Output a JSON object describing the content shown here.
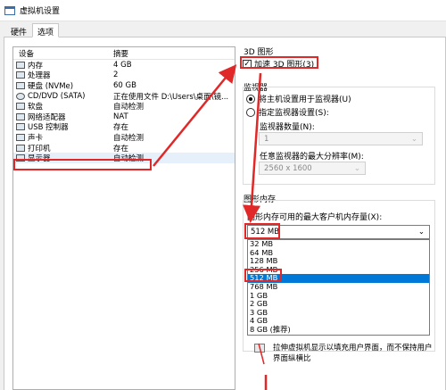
{
  "window": {
    "title": "虚拟机设置"
  },
  "tabs": [
    {
      "label": "硬件"
    },
    {
      "label": "选项"
    }
  ],
  "device_list": {
    "header": {
      "device": "设备",
      "summary": "摘要"
    },
    "rows": [
      {
        "device": "内存",
        "summary": "4 GB",
        "icon": "memory-icon"
      },
      {
        "device": "处理器",
        "summary": "2",
        "icon": "processor-icon"
      },
      {
        "device": "硬盘 (NVMe)",
        "summary": "60 GB",
        "icon": "hard-disk-icon"
      },
      {
        "device": "CD/DVD (SATA)",
        "summary": "正在使用文件 D:\\Users\\桌面\\镜...",
        "icon": "cd-dvd-icon"
      },
      {
        "device": "软盘",
        "summary": "自动检测",
        "icon": "floppy-icon"
      },
      {
        "device": "网络适配器",
        "summary": "NAT",
        "icon": "network-adapter-icon"
      },
      {
        "device": "USB 控制器",
        "summary": "存在",
        "icon": "usb-icon"
      },
      {
        "device": "声卡",
        "summary": "自动检测",
        "icon": "sound-card-icon"
      },
      {
        "device": "打印机",
        "summary": "存在",
        "icon": "printer-icon"
      },
      {
        "device": "显示器",
        "summary": "自动检测",
        "icon": "display-icon"
      }
    ]
  },
  "graphics3d": {
    "section_label": "3D 图形",
    "accelerate_label": "加速 3D 图形(3)",
    "accelerate_checked": true
  },
  "monitors": {
    "section_label": "监视器",
    "use_host_label": "将主机设置用于监视器(U)",
    "specify_label": "指定监视器设置(S):",
    "count_label": "监视器数量(N):",
    "count_value": "1",
    "resolution_label": "任意监视器的最大分辨率(M):",
    "resolution_value": "2560 x 1600"
  },
  "graphics_memory": {
    "section_label": "图形内存",
    "max_label": "图形内存可用的最大客户机内存量(X):",
    "selected_value": "512 MB",
    "options": [
      "32 MB",
      "64 MB",
      "128 MB",
      "256 MB",
      "512 MB",
      "768 MB",
      "1 GB",
      "2 GB",
      "3 GB",
      "4 GB",
      "8 GB (推荐)"
    ],
    "selected_index": 4
  },
  "stretch": {
    "description": "拉伸虚拟机显示以填充用户界面，而不保持用户界面纵横比"
  },
  "colors": {
    "annotation_red": "#e02828",
    "selection_blue": "#0078d7"
  }
}
